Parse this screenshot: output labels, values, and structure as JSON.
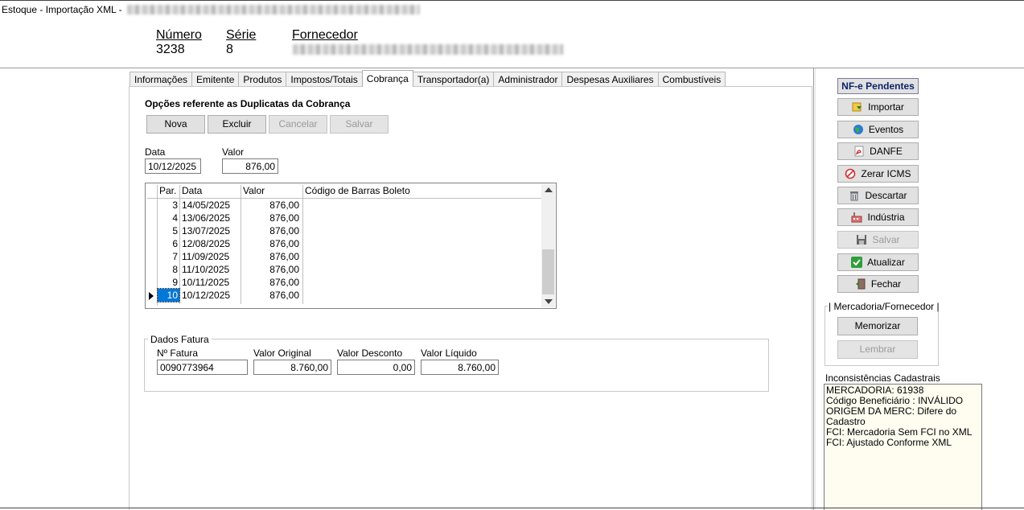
{
  "window": {
    "title": "Estoque - Importação XML  -"
  },
  "header": {
    "numero_label": "Número",
    "numero": "3238",
    "serie_label": "Série",
    "serie": "8",
    "fornecedor_label": "Fornecedor"
  },
  "tabs": [
    "Informações",
    "Emitente",
    "Produtos",
    "Impostos/Totais",
    "Cobrança",
    "Transportador(a)",
    "Administrador",
    "Despesas Auxiliares",
    "Combustíveis"
  ],
  "active_tab": "Cobrança",
  "cobranca": {
    "section_title": "Opções referente as Duplicatas da Cobrança",
    "buttons": {
      "nova": "Nova",
      "excluir": "Excluir",
      "cancelar": "Cancelar",
      "salvar": "Salvar"
    },
    "data_label": "Data",
    "data_value": "10/12/2025",
    "valor_label": "Valor",
    "valor_value": "876,00",
    "grid": {
      "columns": [
        "Par.",
        "Data",
        "Valor",
        "Código de Barras Boleto"
      ],
      "rows": [
        {
          "par": "3",
          "data": "14/05/2025",
          "valor": "876,00",
          "codigo": ""
        },
        {
          "par": "4",
          "data": "13/06/2025",
          "valor": "876,00",
          "codigo": ""
        },
        {
          "par": "5",
          "data": "13/07/2025",
          "valor": "876,00",
          "codigo": ""
        },
        {
          "par": "6",
          "data": "12/08/2025",
          "valor": "876,00",
          "codigo": ""
        },
        {
          "par": "7",
          "data": "11/09/2025",
          "valor": "876,00",
          "codigo": ""
        },
        {
          "par": "8",
          "data": "11/10/2025",
          "valor": "876,00",
          "codigo": ""
        },
        {
          "par": "9",
          "data": "10/11/2025",
          "valor": "876,00",
          "codigo": ""
        },
        {
          "par": "10",
          "data": "10/12/2025",
          "valor": "876,00",
          "codigo": ""
        }
      ],
      "selected_row": 7
    },
    "dados_fatura": {
      "title": "Dados Fatura",
      "n_fatura_label": "Nº Fatura",
      "n_fatura": "0090773964",
      "valor_original_label": "Valor Original",
      "valor_original": "8.760,00",
      "valor_desconto_label": "Valor Desconto",
      "valor_desconto": "0,00",
      "valor_liquido_label": "Valor Líquido",
      "valor_liquido": "8.760,00"
    }
  },
  "sidebar": {
    "nfe_pendentes": "NF-e Pendentes",
    "importar": "Importar",
    "eventos": "Eventos",
    "danfe": "DANFE",
    "zerar_icms": "Zerar ICMS",
    "descartar": "Descartar",
    "industria": "Indústria",
    "salvar": "Salvar",
    "atualizar": "Atualizar",
    "fechar": "Fechar",
    "mercadoria_fornecedor": "| Mercadoria/Fornecedor |",
    "memorizar": "Memorizar",
    "lembrar": "Lembrar",
    "inconsistencias_label": "Inconsistências Cadastrais",
    "inconsistencias": [
      "MERCADORIA: 61938",
      "Código Beneficiário : INVÁLIDO",
      "ORIGEM DA MERC: Difere do Cadastro",
      "FCI: Mercadoria Sem FCI no XML",
      "FCI: Ajustado Conforme XML"
    ]
  },
  "colors": {
    "accent_blue": "#0a246a",
    "selection": "#0078d7",
    "memo_bg": "#fffdf0"
  }
}
